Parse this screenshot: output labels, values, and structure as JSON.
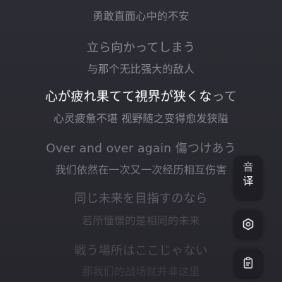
{
  "lyrics": [
    {
      "text": "勇敢直面心中的不安",
      "kind": "trans"
    },
    {
      "text": "立ら向かってしまう",
      "kind": "orig"
    },
    {
      "text": "与那个无比强大的敌人",
      "kind": "trans"
    },
    {
      "text_done": "心が疲れ果てて視界が狭くな",
      "text_rest": "って",
      "kind": "active"
    },
    {
      "text": "心灵疲惫不堪 视野随之变得愈发狭隘",
      "kind": "trans"
    },
    {
      "text": "Over and over again 傷つけあう",
      "kind": "orig"
    },
    {
      "text": "我们依然在一次又一次经历相互伤害",
      "kind": "trans"
    },
    {
      "text": "同じ未来を目指すのなら",
      "kind": "orig"
    },
    {
      "text": "若所憧憬的是相同的未来",
      "kind": "trans"
    },
    {
      "text": "戦う場所はここじゃない",
      "kind": "orig"
    },
    {
      "text": "那我们的战场就并非这里",
      "kind": "trans"
    }
  ],
  "controls": {
    "translate_glyph_top": "音",
    "translate_glyph_bottom": "译",
    "gear_icon": "hexagon-settings-icon",
    "notes_icon": "clipboard-icon"
  }
}
